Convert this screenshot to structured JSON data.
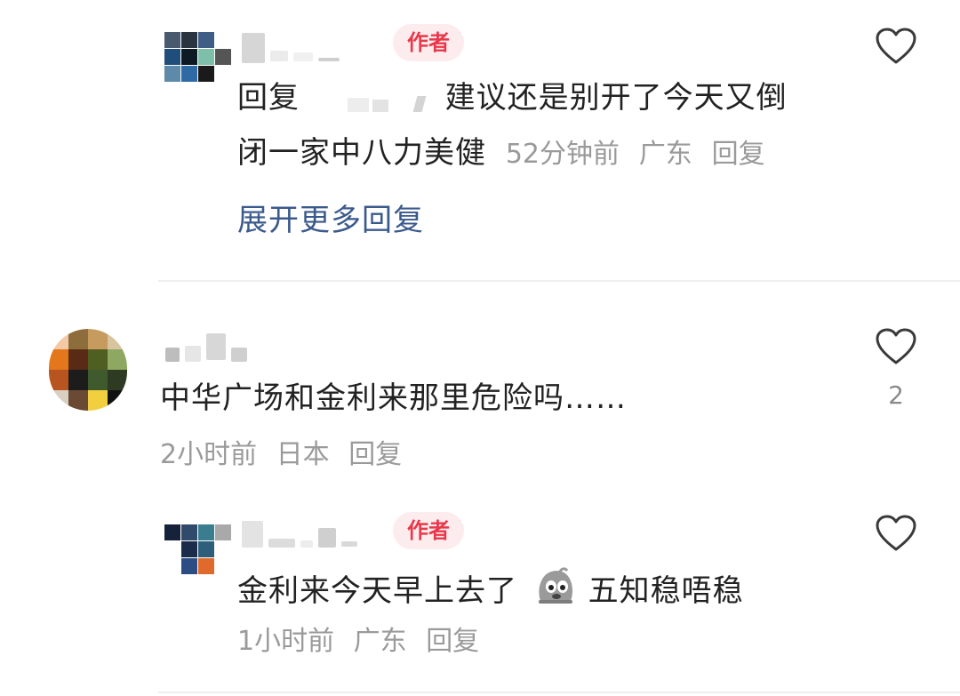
{
  "comments": [
    {
      "author_badge": "作者",
      "text_prefix": "回复",
      "text_line1": "建议还是别开了今天又倒",
      "text_line2": "闭一家中八力美健",
      "time": "52分钟前",
      "location": "广东",
      "reply": "回复",
      "expand_label": "展开更多回复"
    },
    {
      "text": "中华广场和金利来那里危险吗……",
      "like_count": "2",
      "time": "2小时前",
      "location": "日本",
      "reply": "回复"
    },
    {
      "author_badge": "作者",
      "text_before_emoji": "金利来今天早上去了",
      "emoji": "grimacing-face-emoji",
      "text_after_emoji": "五知稳唔稳",
      "time": "1小时前",
      "location": "广东",
      "reply": "回复"
    }
  ],
  "colors": {
    "badge_bg": "#fdecee",
    "badge_text": "#e8394b",
    "expand_link": "#3b5a8c",
    "meta_text": "#9a9a9a"
  }
}
